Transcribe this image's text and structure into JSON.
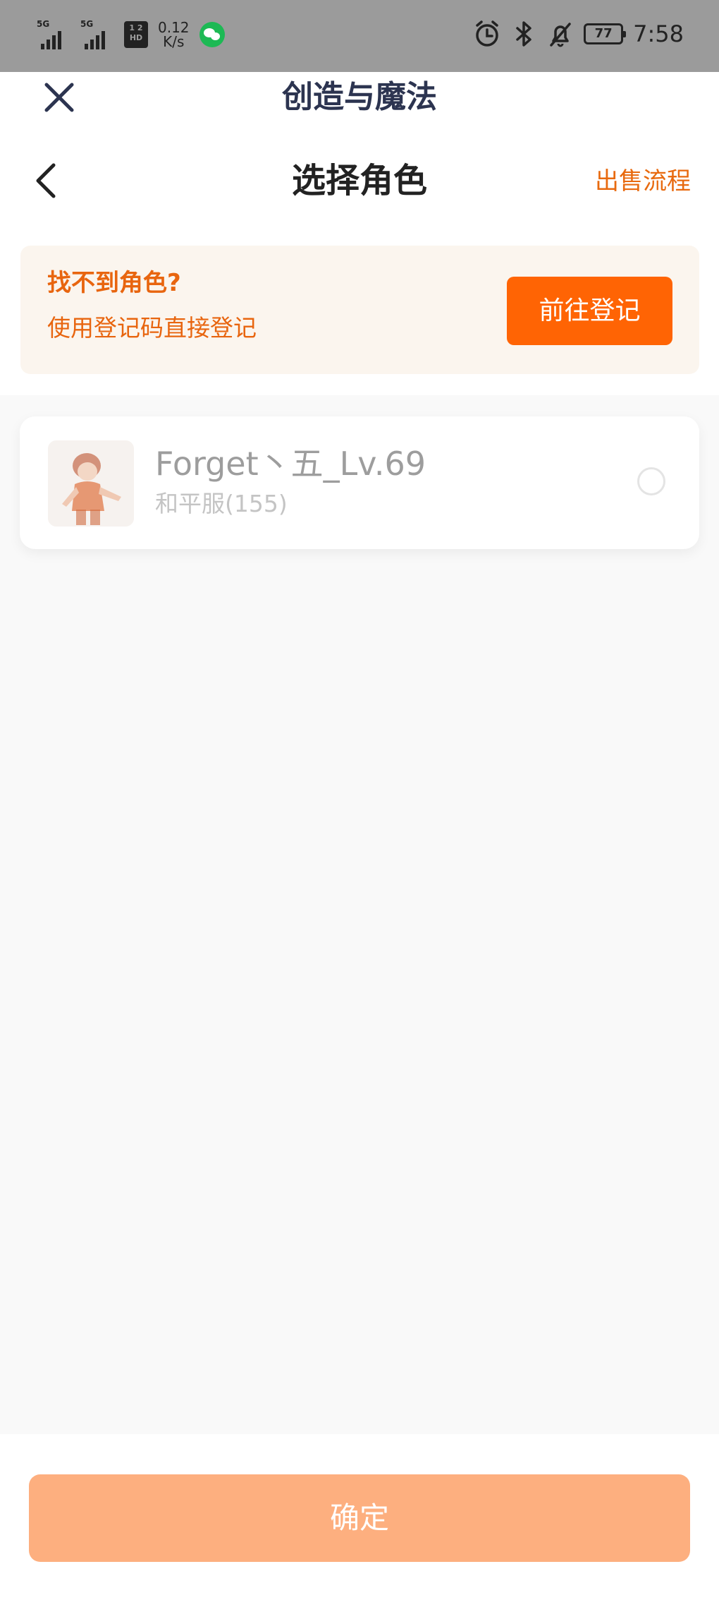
{
  "status_bar": {
    "signal1_label": "5G",
    "signal2_label": "5G",
    "hd_badge_top": "1 2",
    "hd_badge_bottom": "HD",
    "net_speed_value": "0.12",
    "net_speed_unit": "K/s",
    "battery_level": "77",
    "time": "7:58",
    "icons": [
      "signal-icon",
      "signal-icon",
      "hd-icon",
      "wechat-icon",
      "alarm-icon",
      "bluetooth-icon",
      "mute-bell-icon",
      "battery-icon"
    ]
  },
  "header": {
    "app_title": "创造与魔法",
    "page_title": "选择角色",
    "sale_process_label": "出售流程"
  },
  "notice": {
    "title": "找不到角色?",
    "description": "使用登记码直接登记",
    "register_button": "前往登记"
  },
  "characters": [
    {
      "name": "Forget丶五_Lv.69",
      "server": "和平服(155)",
      "selected": false
    }
  ],
  "footer": {
    "confirm_label": "确定"
  },
  "colors": {
    "accent": "#ff6404",
    "accent_text": "#e8650f",
    "confirm_disabled": "#fdaf7f",
    "notice_bg": "#fbf5ee",
    "page_bg": "#f9f9f9"
  }
}
